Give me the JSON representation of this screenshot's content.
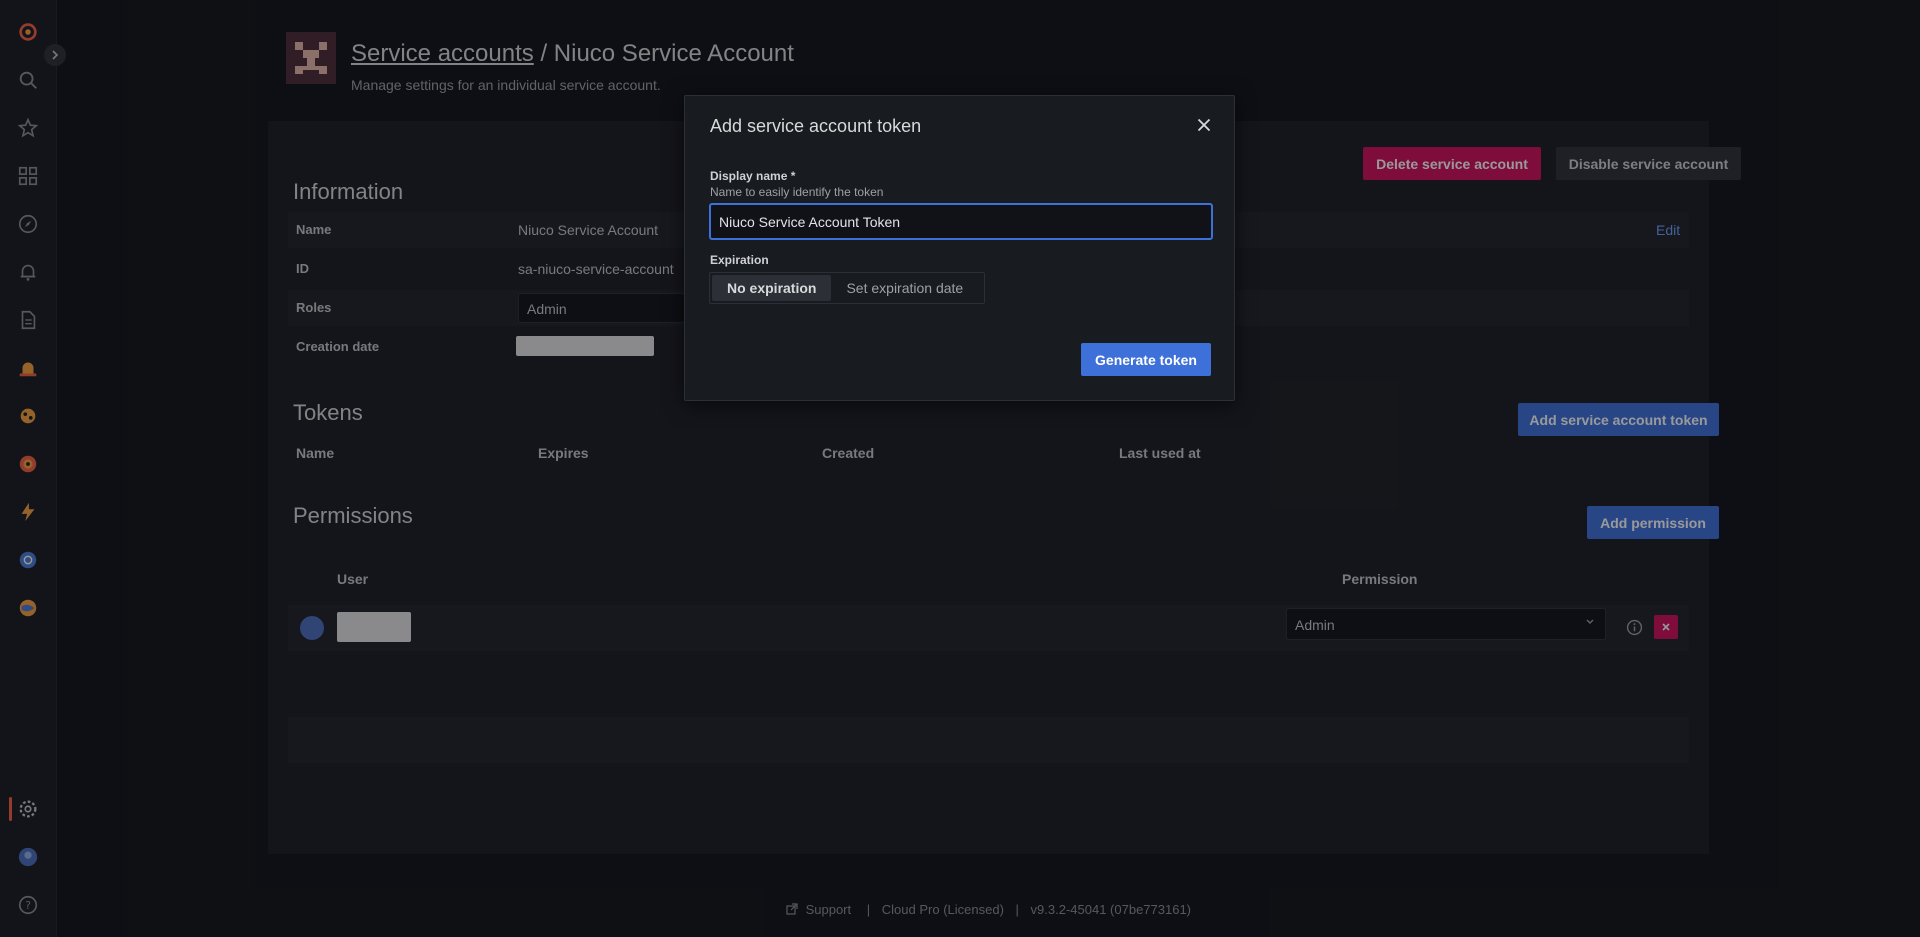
{
  "header": {
    "breadcrumb_link": "Service accounts",
    "separator": "/",
    "title": "Niuco Service Account",
    "subtitle": "Manage settings for an individual service account."
  },
  "actions": {
    "delete": "Delete service account",
    "disable": "Disable service account"
  },
  "information": {
    "title": "Information",
    "edit": "Edit",
    "rows": [
      {
        "label": "Name",
        "value": "Niuco Service Account"
      },
      {
        "label": "ID",
        "value": "sa-niuco-service-account"
      },
      {
        "label": "Roles",
        "value": "Admin"
      },
      {
        "label": "Creation date",
        "value": ""
      }
    ]
  },
  "tokens": {
    "title": "Tokens",
    "add_button": "Add service account token",
    "columns": [
      "Name",
      "Expires",
      "Created",
      "Last used at"
    ]
  },
  "permissions": {
    "title": "Permissions",
    "add_button": "Add permission",
    "col_user": "User",
    "col_permission": "Permission",
    "row": {
      "permission": "Admin"
    }
  },
  "footer": {
    "support": "Support",
    "edition": "Cloud Pro (Licensed)",
    "version": "v9.3.2-45041 (07be773161)"
  },
  "modal": {
    "title": "Add service account token",
    "display_name_label": "Display name *",
    "display_name_desc": "Name to easily identify the token",
    "display_name_value": "Niuco Service Account Token",
    "expiration_label": "Expiration",
    "options": [
      "No expiration",
      "Set expiration date"
    ],
    "selected_option": "No expiration",
    "generate": "Generate token"
  },
  "colors": {
    "accent": "#3d71d9",
    "danger": "#d10e5c",
    "brand": "#f55f3e"
  }
}
